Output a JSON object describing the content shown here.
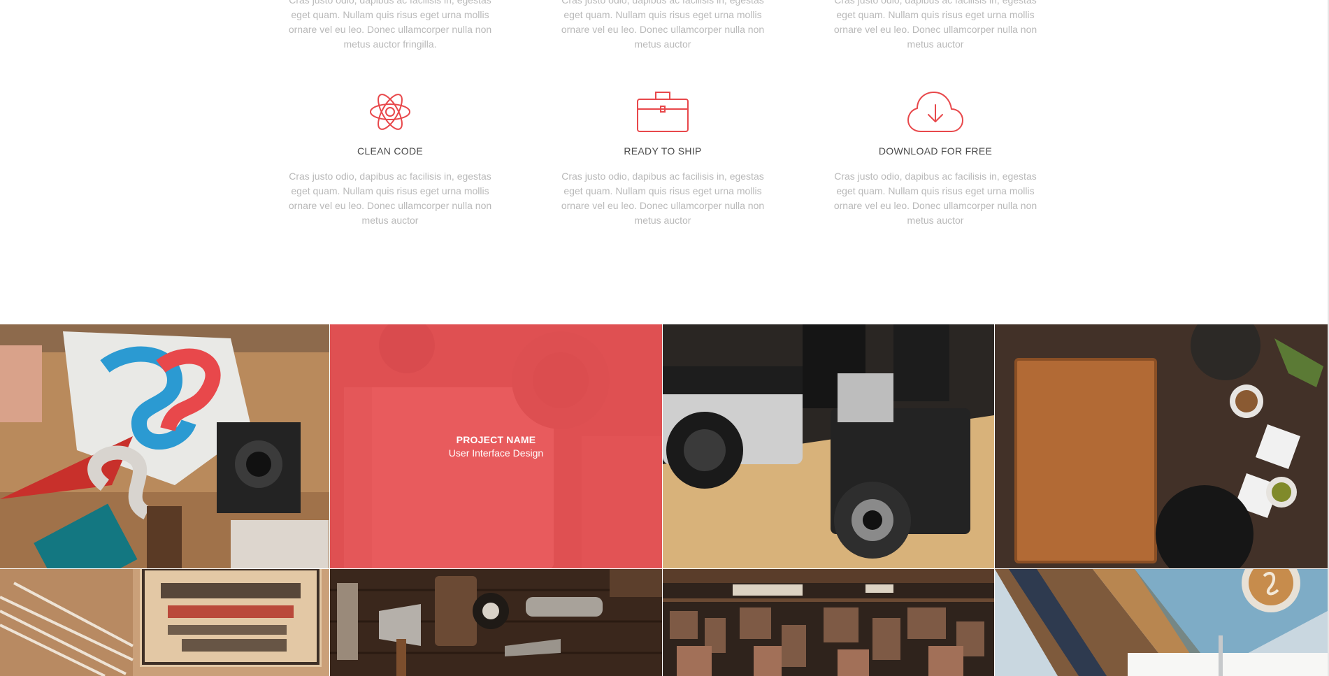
{
  "services_top": [
    {
      "text": "Cras justo odio, dapibus ac facilisis in, egestas eget quam. Nullam quis risus eget urna mollis ornare vel eu leo. Donec ullamcorper nulla non metus auctor fringilla."
    },
    {
      "text": "Cras justo odio, dapibus ac facilisis in, egestas eget quam. Nullam quis risus eget urna mollis ornare vel eu leo. Donec ullamcorper nulla non metus auctor"
    },
    {
      "text": "Cras justo odio, dapibus ac facilisis in, egestas eget quam. Nullam quis risus eget urna mollis ornare vel eu leo. Donec ullamcorper nulla non metus auctor"
    }
  ],
  "services": [
    {
      "icon": "atom-icon",
      "title": "CLEAN CODE",
      "text": "Cras justo odio, dapibus ac facilisis in, egestas eget quam. Nullam quis risus eget urna mollis ornare vel eu leo. Donec ullamcorper nulla non metus auctor"
    },
    {
      "icon": "briefcase-icon",
      "title": "READY TO SHIP",
      "text": "Cras justo odio, dapibus ac facilisis in, egestas eget quam. Nullam quis risus eget urna mollis ornare vel eu leo. Donec ullamcorper nulla non metus auctor"
    },
    {
      "icon": "cloud-download-icon",
      "title": "DOWNLOAD FOR FREE",
      "text": "Cras justo odio, dapibus ac facilisis in, egestas eget quam. Nullam quis risus eget urna mollis ornare vel eu leo. Donec ullamcorper nulla non metus auctor"
    }
  ],
  "portfolio": {
    "hover_overlay": {
      "title": "PROJECT NAME",
      "subtitle": "User Interface Design"
    },
    "tiles": [
      {
        "image": "back-to-school-flatlay"
      },
      {
        "image": "dont-stop-there-notebook"
      },
      {
        "image": "vintage-cameras"
      },
      {
        "image": "kitchen-cutting-board"
      },
      {
        "image": "salt-codfish-box"
      },
      {
        "image": "vintage-tools"
      },
      {
        "image": "wood-type-letters"
      },
      {
        "image": "latte-coffee-table"
      }
    ]
  },
  "colors": {
    "accent": "#e8484b",
    "heading": "#4a4a4a",
    "body_text": "#b9b9b9",
    "background": "#ffffff"
  }
}
